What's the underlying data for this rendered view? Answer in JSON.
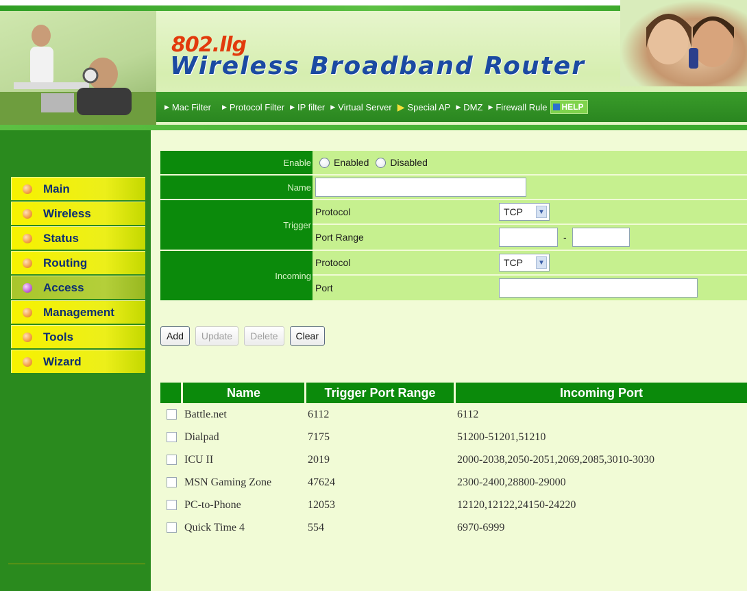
{
  "header": {
    "brand_prefix": "802.llg",
    "title": "Wireless Broadband Router",
    "nav": [
      {
        "label": "Mac Filter"
      },
      {
        "label": "Protocol Filter"
      },
      {
        "label": "IP filter"
      },
      {
        "label": "Virtual Server"
      },
      {
        "label": "Special AP"
      },
      {
        "label": "DMZ"
      },
      {
        "label": "Firewall Rule"
      }
    ],
    "help_label": "HELP"
  },
  "sidebar": {
    "items": [
      {
        "label": "Main"
      },
      {
        "label": "Wireless"
      },
      {
        "label": "Status"
      },
      {
        "label": "Routing"
      },
      {
        "label": "Access"
      },
      {
        "label": "Management"
      },
      {
        "label": "Tools"
      },
      {
        "label": "Wizard"
      }
    ]
  },
  "form": {
    "enable_label": "Enable",
    "enabled_option": "Enabled",
    "disabled_option": "Disabled",
    "name_label": "Name",
    "name_value": "",
    "trigger_label": "Trigger",
    "trigger_protocol_label": "Protocol",
    "trigger_protocol_value": "TCP",
    "port_range_label": "Port Range",
    "port_range_start": "",
    "port_range_end": "",
    "port_range_separator": "-",
    "incoming_label": "Incoming",
    "incoming_protocol_label": "Protocol",
    "incoming_protocol_value": "TCP",
    "incoming_port_label": "Port",
    "incoming_port_value": ""
  },
  "buttons": {
    "add": "Add",
    "update": "Update",
    "delete": "Delete",
    "clear": "Clear"
  },
  "table": {
    "headers": {
      "name": "Name",
      "trigger": "Trigger Port Range",
      "incoming": "Incoming Port"
    },
    "rows": [
      {
        "name": "Battle.net",
        "trigger": "6112",
        "incoming": "6112"
      },
      {
        "name": "Dialpad",
        "trigger": "7175",
        "incoming": "51200-51201,51210"
      },
      {
        "name": "ICU II",
        "trigger": "2019",
        "incoming": "2000-2038,2050-2051,2069,2085,3010-3030"
      },
      {
        "name": "MSN Gaming Zone",
        "trigger": "47624",
        "incoming": "2300-2400,28800-29000"
      },
      {
        "name": "PC-to-Phone",
        "trigger": "12053",
        "incoming": "12120,12122,24150-24220"
      },
      {
        "name": "Quick Time 4",
        "trigger": "554",
        "incoming": "6970-6999"
      }
    ]
  }
}
